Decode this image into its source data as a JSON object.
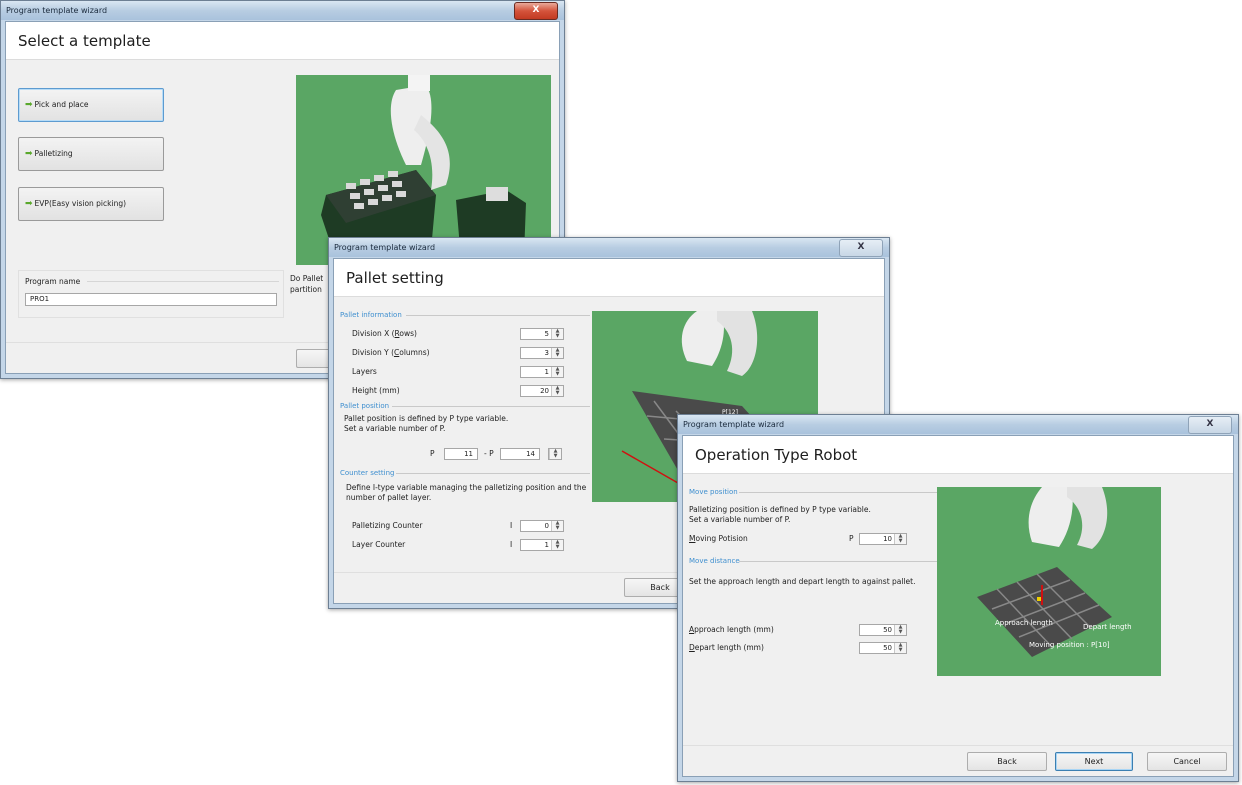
{
  "window1": {
    "title": "Program template wizard",
    "close": "X",
    "header": "Select a template",
    "templates": [
      "Pick and place",
      "Palletizing",
      "EVP(Easy vision picking)"
    ],
    "program_name_label": "Program name",
    "program_name_value": "PRO1",
    "desc_line1": "Do Pallet",
    "desc_line2": "partition"
  },
  "window2": {
    "title": "Program template wizard",
    "close": "X",
    "header": "Pallet setting",
    "sections": {
      "pallet_info": "Pallet information",
      "pallet_position": "Pallet position",
      "counter": "Counter setting"
    },
    "fields": {
      "div_x_label": "Division X (Rows)",
      "div_x": "5",
      "div_y_label": "Division Y (Columns)",
      "div_y": "3",
      "layers_label": "Layers",
      "layers": "1",
      "height_label": "Height (mm)",
      "height": "20"
    },
    "pos_text1": "Pallet position is defined by P type variable.",
    "pos_text2": "Set a variable number of P.",
    "p_label1": "P",
    "p_from": "11",
    "p_sep": "- P",
    "p_to": "14",
    "counter_text1": "Define I-type variable managing the palletizing position and the",
    "counter_text2": "number of pallet layer.",
    "pal_counter_label": "Palletizing Counter",
    "pal_counter_prefix": "I",
    "pal_counter": "0",
    "layer_counter_label": "Layer Counter",
    "layer_counter_prefix": "I",
    "layer_counter": "1",
    "pallet_tag": "P[12]",
    "back": "Back"
  },
  "window3": {
    "title": "Program template wizard",
    "close": "X",
    "header": "Operation Type Robot",
    "move_position": "Move position",
    "mp_text1": "Palletizing position is defined by P type variable.",
    "mp_text2": "Set a variable number of P.",
    "moving_label": "Moving Potision",
    "moving_prefix": "P",
    "moving_value": "10",
    "move_distance": "Move distance",
    "md_text": "Set the approach length and depart length to against pallet.",
    "approach_label": "Approach length (mm)",
    "approach_value": "50",
    "depart_label": "Depart length (mm)",
    "depart_value": "50",
    "img_approach": "Approach length",
    "img_depart": "Depart length",
    "img_moving": "Moving position : P[10]",
    "back": "Back",
    "next": "Next",
    "cancel": "Cancel"
  }
}
